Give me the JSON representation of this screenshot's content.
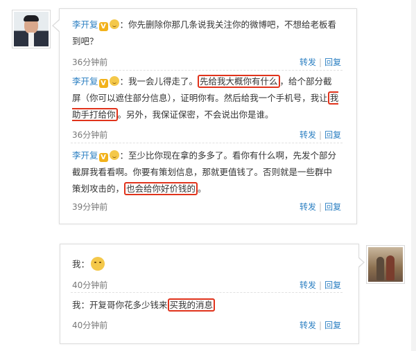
{
  "thread": [
    {
      "sender": "李开复",
      "text_before": "：你先删除你那几条说我关注你的微博吧，不想给老板看到吧？",
      "time": "36分钟前",
      "actions": [
        "转发",
        "回复"
      ]
    },
    {
      "sender": "李开复",
      "text_1": "：我一会儿得走了。",
      "highlight_1": "先给我大概你有什么",
      "text_2": "，给个部分截屏（你可以遮住部分信息），证明你有。然后给我一个手机号，我让",
      "highlight_2": "我助手打给你",
      "text_3": "。另外，我保证保密，不会说出你是谁。",
      "time": "36分钟前",
      "actions": [
        "转发",
        "回复"
      ]
    },
    {
      "sender": "李开复",
      "text_1": "：至少比你现在拿的多多了。看你有什么啊，先发个部分截屏我看看啊。你要有策划信息，那就更值钱了。否则就是一些群中策划攻击的，",
      "highlight_1": "也会给你好价钱的",
      "text_2": "。",
      "time": "39分钟前",
      "actions": [
        "转发",
        "回复"
      ]
    }
  ],
  "replies": [
    {
      "sender": "我",
      "text": "：",
      "time": "40分钟前",
      "actions": [
        "转发",
        "回复"
      ]
    },
    {
      "sender": "我",
      "text_1": "：开复哥你花多少钱来",
      "highlight_1": "买我的消息",
      "time": "40分钟前",
      "actions": [
        "转发",
        "回复"
      ]
    }
  ],
  "icons": {
    "verified_badge": "V",
    "emoji": "smile-emoji-icon",
    "big_emoji": "grin-emoji-icon"
  },
  "colors": {
    "name_link": "#2b7fc2",
    "highlight_box": "#e0321b",
    "badge": "#f2b21b"
  }
}
